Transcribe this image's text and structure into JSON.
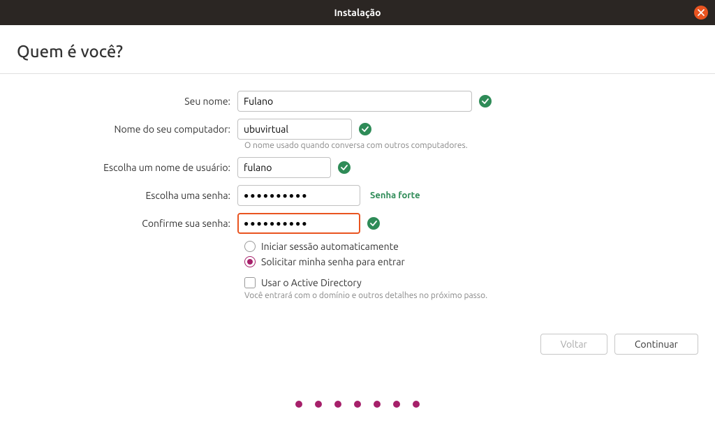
{
  "titlebar": {
    "title": "Instalação"
  },
  "page": {
    "title": "Quem é você?"
  },
  "form": {
    "name": {
      "label": "Seu nome:",
      "value": "Fulano"
    },
    "computer": {
      "label": "Nome do seu computador:",
      "value": "ubuvirtual",
      "hint": "O nome usado quando conversa com outros computadores."
    },
    "username": {
      "label": "Escolha um nome de usuário:",
      "value": "fulano"
    },
    "password": {
      "label": "Escolha uma senha:",
      "value": "●●●●●●●●●●",
      "strength": "Senha forte"
    },
    "confirm": {
      "label": "Confirme sua senha:",
      "value": "●●●●●●●●●●"
    },
    "login_auto": "Iniciar sessão automaticamente",
    "login_password": "Solicitar minha senha para entrar",
    "ad": {
      "label": "Usar o Active Directory",
      "hint": "Você entrará com o domínio e outros detalhes no próximo passo."
    }
  },
  "buttons": {
    "back": "Voltar",
    "continue": "Continuar"
  }
}
